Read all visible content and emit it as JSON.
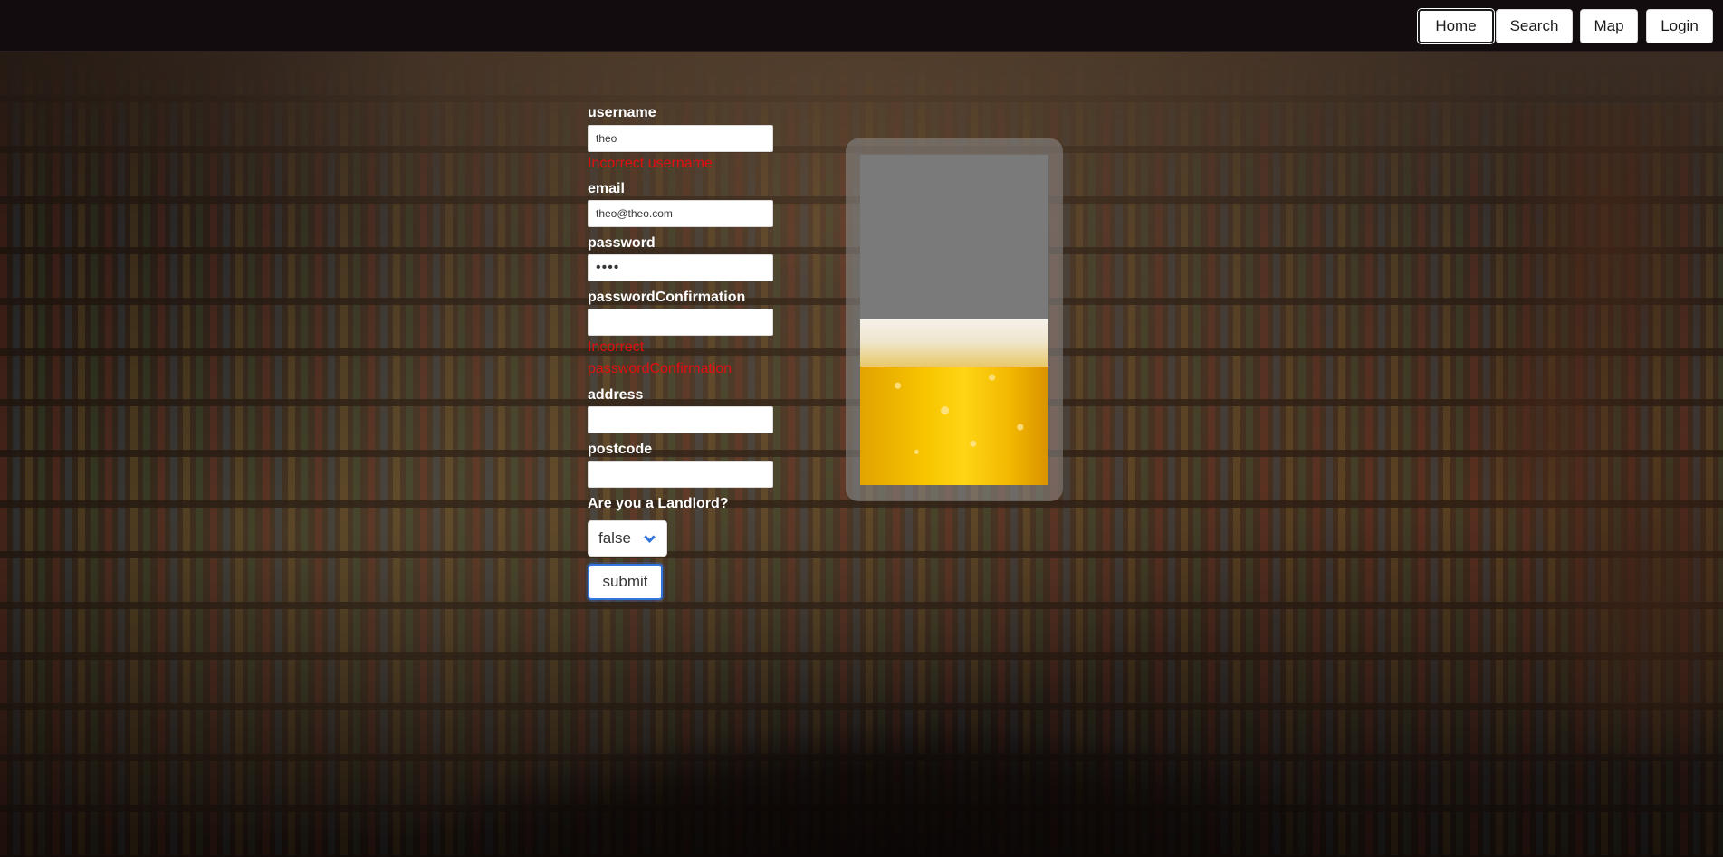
{
  "navbar": {
    "buttons": [
      {
        "label": "Home",
        "active": true
      },
      {
        "label": "Search",
        "active": false
      },
      {
        "label": "Map",
        "active": false
      },
      {
        "label": "Login",
        "active": false
      }
    ]
  },
  "form": {
    "username": {
      "label": "username",
      "value": "theo",
      "error": "Incorrect username"
    },
    "email": {
      "label": "email",
      "value": "theo@theo.com"
    },
    "password": {
      "label": "password",
      "value": "••••"
    },
    "passwordConfirmation": {
      "label": "passwordConfirmation",
      "value": "",
      "error": "Incorrect passwordConfirmation"
    },
    "address": {
      "label": "address",
      "value": ""
    },
    "postcode": {
      "label": "postcode",
      "value": ""
    },
    "landlord": {
      "label": "Are you a Landlord?",
      "selected": "false"
    },
    "submit_label": "submit"
  },
  "beer_glass": {
    "fill_fraction": 0.5
  },
  "colors": {
    "navbar_bg": "#130c0e",
    "error_text": "#e01010",
    "accent": "#3273dc",
    "beer": "#f8c500"
  }
}
